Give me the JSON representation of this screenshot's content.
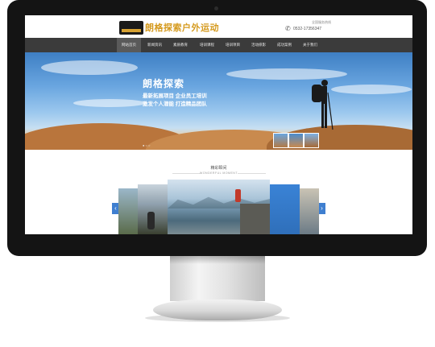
{
  "header": {
    "logo_text": "朗格探索户外运动",
    "hotline_label": "全国服务热线",
    "phone": "0532-17356347"
  },
  "nav": {
    "items": [
      {
        "label": "网站首页"
      },
      {
        "label": "新闻资讯"
      },
      {
        "label": "素质教育"
      },
      {
        "label": "培训课程"
      },
      {
        "label": "培训项目"
      },
      {
        "label": "活动掠影"
      },
      {
        "label": "成功案例"
      },
      {
        "label": "关于我们"
      }
    ]
  },
  "banner": {
    "title": "朗格探索",
    "line1": "最新拓展项目  企业员工培训",
    "line2": "激发个人潜能  打造精品团队",
    "pager": "● ○ ○"
  },
  "gallery": {
    "title": "精彩瞬间",
    "subtitle": "WONDERFUL MOMENT",
    "prev_icon": "chevron-left-icon",
    "next_icon": "chevron-right-icon"
  },
  "colors": {
    "accent": "#3f7fd0",
    "nav_bg": "#3b3b3b",
    "logo": "#d59a1e"
  }
}
